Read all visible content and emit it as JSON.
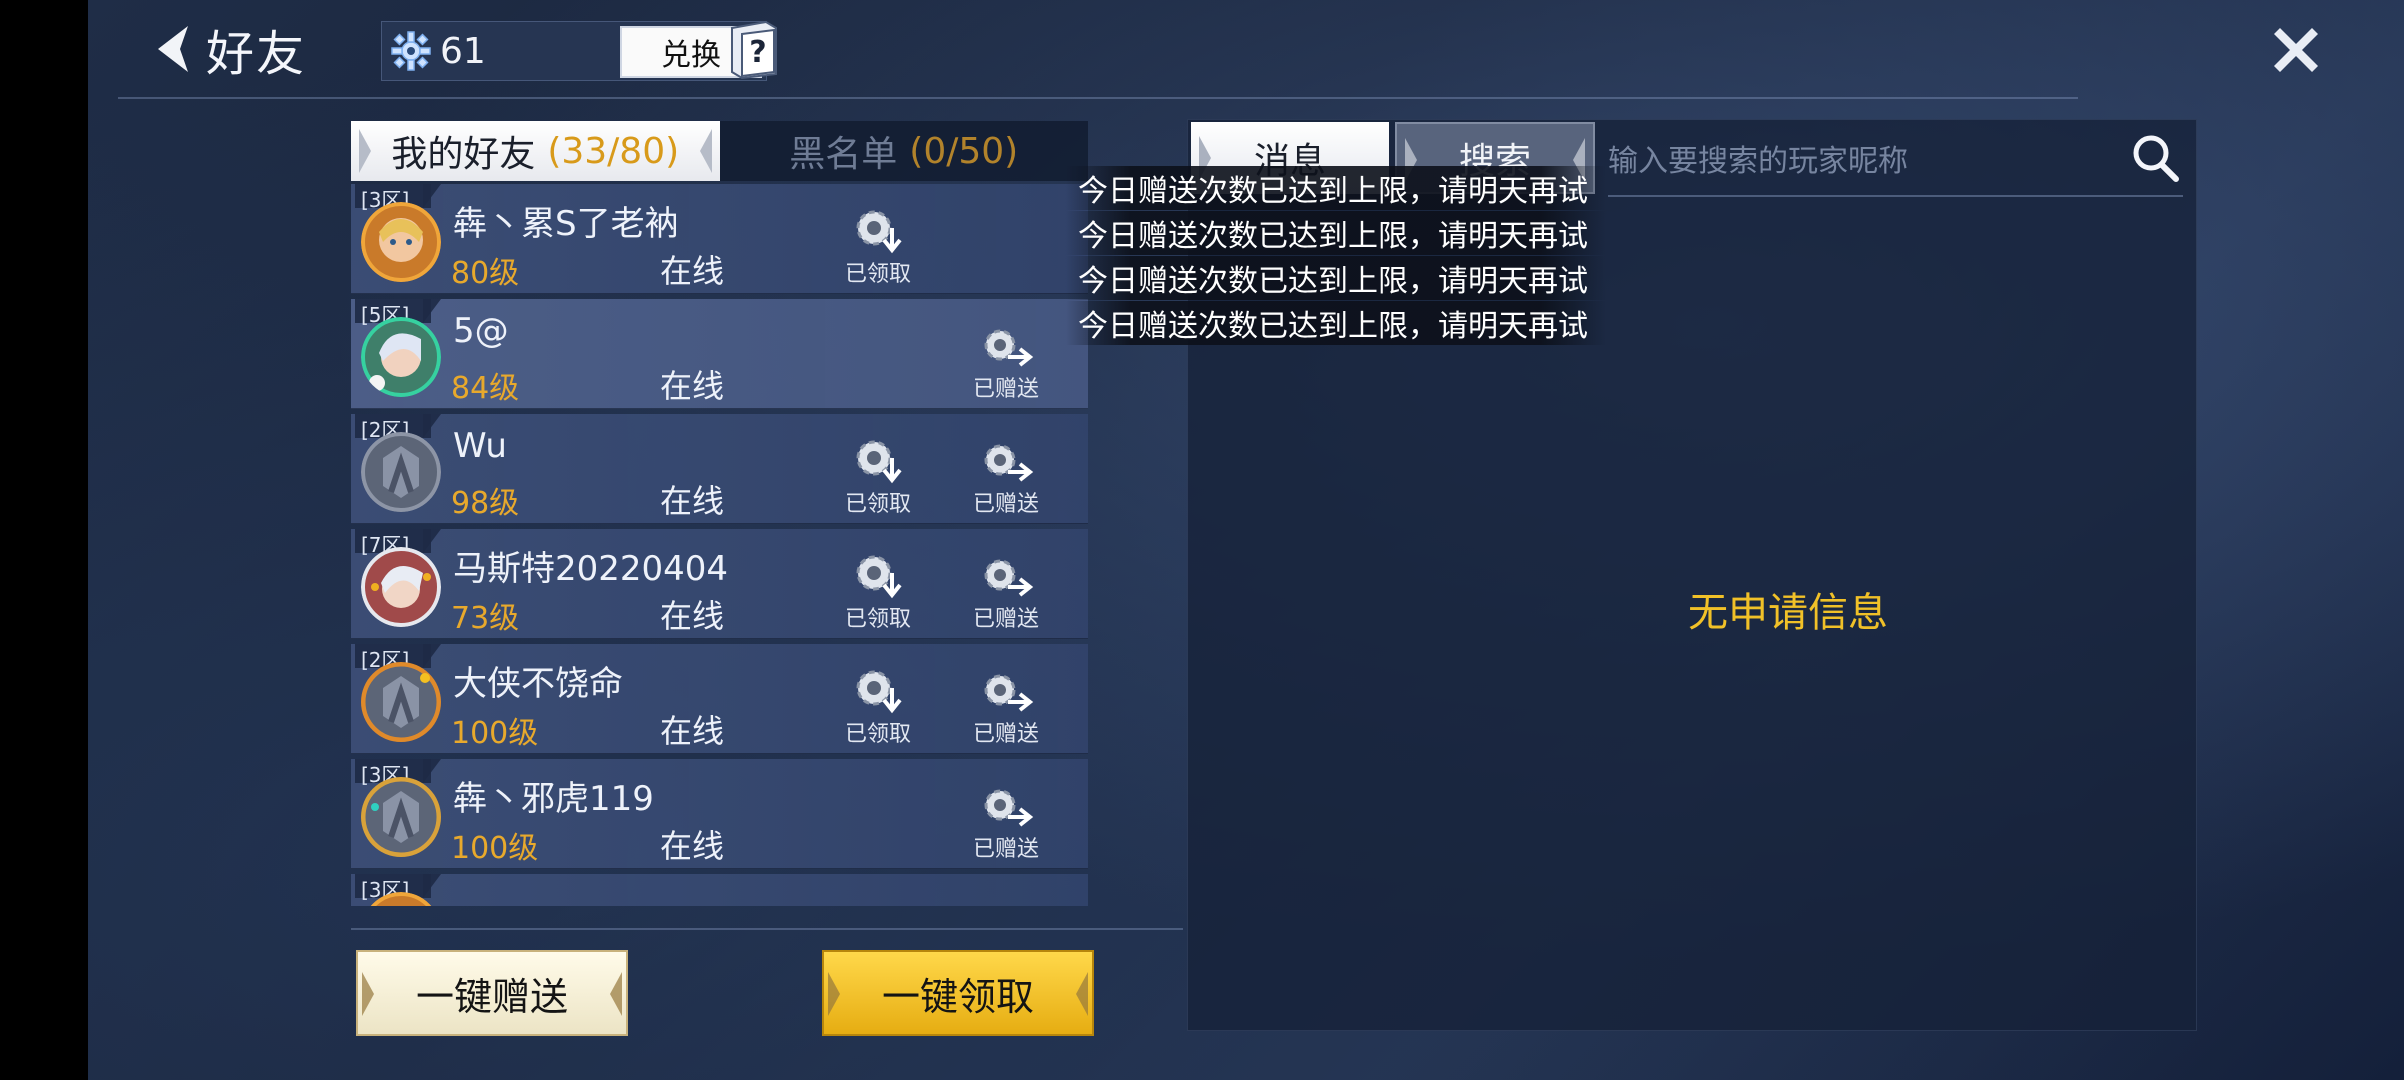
{
  "header": {
    "title": "好友",
    "currency_count": "61",
    "exchange_label": "兑换"
  },
  "tabs_left": {
    "friends_label": "我的好友",
    "friends_count": "(33/80)",
    "blacklist_label": "黑名单",
    "blacklist_count": "(0/50)"
  },
  "friends": [
    {
      "zone": "[3区]",
      "name": "犇丶累S了老衲",
      "level": "80级",
      "status": "在线",
      "claim_label": "已领取",
      "send_label": ""
    },
    {
      "zone": "[5区]",
      "name": "5@",
      "level": "84级",
      "status": "在线",
      "claim_label": "",
      "send_label": "已赠送"
    },
    {
      "zone": "[2区]",
      "name": "Wu",
      "level": "98级",
      "status": "在线",
      "claim_label": "已领取",
      "send_label": "已赠送"
    },
    {
      "zone": "[7区]",
      "name": "马斯特20220404",
      "level": "73级",
      "status": "在线",
      "claim_label": "已领取",
      "send_label": "已赠送"
    },
    {
      "zone": "[2区]",
      "name": "大侠不饶命",
      "level": "100级",
      "status": "在线",
      "claim_label": "已领取",
      "send_label": "已赠送"
    },
    {
      "zone": "[3区]",
      "name": "犇丶邪虎119",
      "level": "100级",
      "status": "在线",
      "claim_label": "",
      "send_label": "已赠送"
    },
    {
      "zone": "[3区]",
      "name": "",
      "level": "",
      "status": "",
      "claim_label": "",
      "send_label": ""
    }
  ],
  "bottom_buttons": {
    "send_all": "一键赠送",
    "claim_all": "一键领取"
  },
  "right_panel": {
    "tab_messages": "消息",
    "tab_search": "搜索",
    "search_placeholder": "输入要搜索的玩家昵称",
    "empty_message": "无申请信息"
  },
  "toasts": [
    "今日赠送次数已达到上限，请明天再试",
    "今日赠送次数已达到上限，请明天再试",
    "今日赠送次数已达到上限，请明天再试",
    "今日赠送次数已达到上限，请明天再试"
  ],
  "colors": {
    "accent_gold": "#e8a92c",
    "empty_text": "#f1c128",
    "claim_button": "#ffd84a"
  }
}
